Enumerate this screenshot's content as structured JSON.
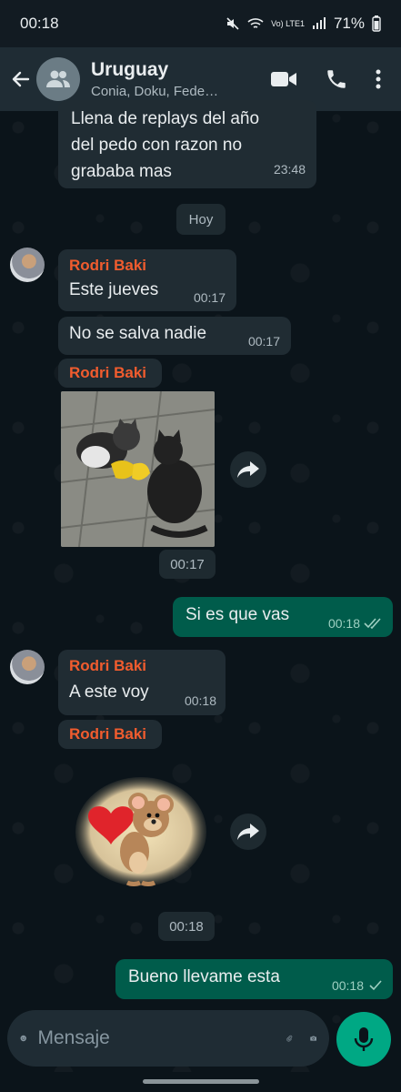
{
  "status": {
    "time": "00:18",
    "network": "Vo) LTE1",
    "battery": "71%"
  },
  "header": {
    "title": "Uruguay",
    "subtitle": "Conia, Doku, Fede…"
  },
  "messages": {
    "m1": {
      "text_line1": "Llena de replays del año",
      "text_line2": "del pedo con razon no",
      "text_line3": "grababa mas",
      "time": "23:48"
    },
    "date_separator": "Hoy",
    "m2": {
      "sender": "Rodri Baki",
      "text": "Este jueves",
      "time": "00:17"
    },
    "m3": {
      "text": "No se salva nadie",
      "time": "00:17"
    },
    "m4": {
      "sender": "Rodri Baki",
      "time": "00:17"
    },
    "m5": {
      "text": "Si es que vas",
      "time": "00:18"
    },
    "m6": {
      "sender": "Rodri Baki",
      "text": "A este voy",
      "time": "00:18"
    },
    "m7": {
      "sender": "Rodri Baki",
      "time": "00:18"
    },
    "m8": {
      "text": "Bueno llevame esta",
      "time": "00:18"
    }
  },
  "composer": {
    "placeholder": "Mensaje"
  },
  "colors": {
    "bg": "#0b141a",
    "incoming": "#202c33",
    "outgoing": "#005c4b",
    "sender_name": "#f15c2e",
    "accent": "#00a884"
  },
  "icons": [
    "back-arrow-icon",
    "group-avatar-icon",
    "video-call-icon",
    "phone-icon",
    "more-vert-icon",
    "forward-icon",
    "emoji-icon",
    "attach-icon",
    "camera-icon",
    "mic-icon",
    "double-check-icon",
    "check-icon"
  ]
}
